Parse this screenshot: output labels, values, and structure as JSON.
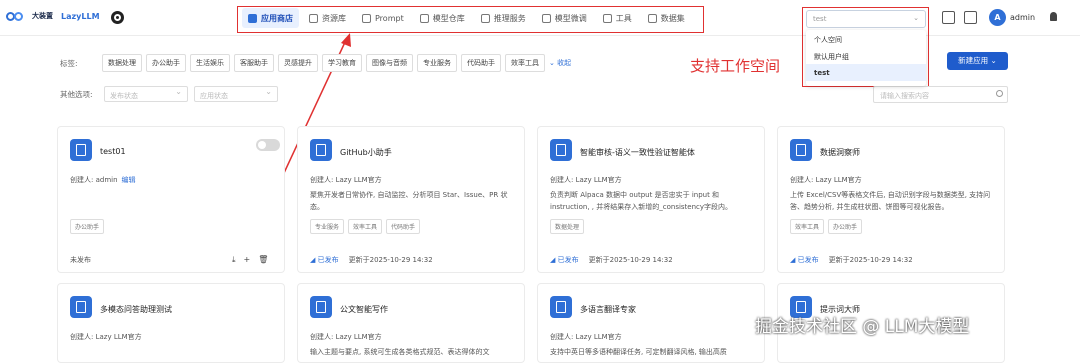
{
  "brand": {
    "mark_text": "大装置",
    "name": "LazyLLM"
  },
  "nav": {
    "items": [
      {
        "label": "应用商店",
        "icon": "store-icon",
        "active": true
      },
      {
        "label": "资源库",
        "icon": "library-icon",
        "active": false
      },
      {
        "label": "Prompt",
        "icon": "prompt-icon",
        "active": false
      },
      {
        "label": "模型仓库",
        "icon": "model-repo-icon",
        "active": false
      },
      {
        "label": "推理服务",
        "icon": "inference-icon",
        "active": false
      },
      {
        "label": "模型微调",
        "icon": "finetune-icon",
        "active": false
      },
      {
        "label": "工具",
        "icon": "tools-icon",
        "active": false
      },
      {
        "label": "数据集",
        "icon": "dataset-icon",
        "active": false
      }
    ]
  },
  "workspace": {
    "selected": "test",
    "options": [
      "个人空间",
      "默认用户组",
      "test"
    ],
    "selected_index": 2
  },
  "user": {
    "avatar_letter": "A",
    "name": "admin"
  },
  "annotation": "支持工作空间",
  "filters": {
    "tags_label": "标签:",
    "tags": [
      "数据处理",
      "办公助手",
      "生活娱乐",
      "客服助手",
      "灵感提升",
      "学习教育",
      "图像与音频",
      "专业服务",
      "代码助手",
      "效率工具"
    ],
    "collapse_label": "收起",
    "other_label": "其他选项:",
    "publish_placeholder": "发布状态",
    "app_status_placeholder": "应用状态",
    "search_placeholder": "请输入搜索内容",
    "new_app_label": "新建应用"
  },
  "cards": [
    {
      "title": "test01",
      "creator": "创建人: admin",
      "edit_label": "编辑",
      "desc": "",
      "tags": [
        "办公助手"
      ],
      "status": "未发布",
      "updated": "",
      "has_toggle": true
    },
    {
      "title": "GitHub小助手",
      "creator": "创建人: Lazy LLM官方",
      "desc": "聚焦开发者日常协作, 自动监控、分析项目 Star、Issue、PR 状态。",
      "tags": [
        "专业服务",
        "效率工具",
        "代码助手"
      ],
      "status": "已发布",
      "updated": "更新于2025-10-29 14:32"
    },
    {
      "title": "智能审核-语义一致性验证智能体",
      "creator": "创建人: Lazy LLM官方",
      "desc": "负责判断 Alpaca 数据中 output 是否忠实于 input 和 instruction, , 并将结果存入新增的_consistency字段内。",
      "tags": [
        "数据处理"
      ],
      "status": "已发布",
      "updated": "更新于2025-10-29 14:32"
    },
    {
      "title": "数据洞察师",
      "creator": "创建人: Lazy LLM官方",
      "desc": "上传 Excel/CSV等表格文件后, 自动识别字段与数据类型, 支持问答、趋势分析, 并生成柱状图、饼图等可视化报告。",
      "tags": [
        "效率工具",
        "办公助手"
      ],
      "status": "已发布",
      "updated": "更新于2025-10-29 14:32"
    },
    {
      "title": "多模态问答助理测试",
      "creator": "创建人: Lazy LLM官方",
      "desc": "",
      "tags": []
    },
    {
      "title": "公文智能写作",
      "creator": "创建人: Lazy LLM官方",
      "desc": "输入主题与要点, 系统可生成各类格式规范、表达得体的文",
      "tags": []
    },
    {
      "title": "多语言翻译专家",
      "creator": "创建人: Lazy LLM官方",
      "desc": "支持中英日等多语种翻译任务, 可定制翻译风格, 输出高质",
      "tags": []
    },
    {
      "title": "提示词大师",
      "creator": "",
      "desc": "",
      "tags": []
    }
  ],
  "watermark": "掘金技术社区 @ LLM大模型"
}
